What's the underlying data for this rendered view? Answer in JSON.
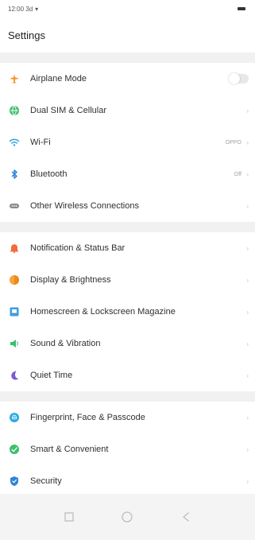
{
  "status": {
    "time": "12:00 3d"
  },
  "header": {
    "title": "Settings"
  },
  "groups": [
    [
      {
        "label": "Airplane Mode",
        "icon": "airplane-icon",
        "color": "#f29b38",
        "toggle": false
      },
      {
        "label": "Dual SIM & Cellular",
        "icon": "globe-icon",
        "color": "#3dbf6e"
      },
      {
        "label": "Wi-Fi",
        "icon": "wifi-icon",
        "color": "#29a8e6",
        "value": "OPPO"
      },
      {
        "label": "Bluetooth",
        "icon": "bluetooth-icon",
        "color": "#2b84d6",
        "value": "Off"
      },
      {
        "label": "Other Wireless Connections",
        "icon": "wireless-icon",
        "color": "#8b8b8b"
      }
    ],
    [
      {
        "label": "Notification & Status Bar",
        "icon": "bell-icon",
        "color": "#f26b3a"
      },
      {
        "label": "Display & Brightness",
        "icon": "brightness-icon",
        "color": "#f4a53d"
      },
      {
        "label": "Homescreen & Lockscreen Magazine",
        "icon": "homescreen-icon",
        "color": "#3d9de0"
      },
      {
        "label": "Sound & Vibration",
        "icon": "sound-icon",
        "color": "#39c16c"
      },
      {
        "label": "Quiet Time",
        "icon": "moon-icon",
        "color": "#7a5bd6"
      }
    ],
    [
      {
        "label": "Fingerprint, Face & Passcode",
        "icon": "fingerprint-icon",
        "color": "#30a9e5"
      },
      {
        "label": "Smart & Convenient",
        "icon": "smart-icon",
        "color": "#3cc06c"
      },
      {
        "label": "Security",
        "icon": "shield-icon",
        "color": "#2e83db"
      }
    ]
  ],
  "nav": {
    "buttons": [
      "recent-apps-icon",
      "home-icon",
      "back-icon"
    ]
  }
}
